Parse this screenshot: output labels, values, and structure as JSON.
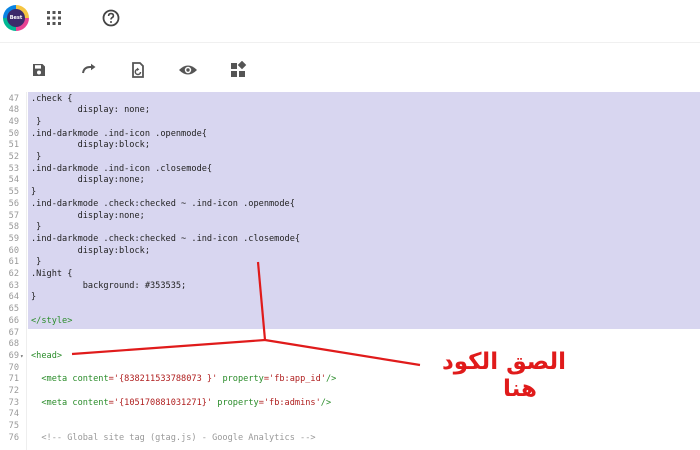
{
  "header": {
    "logo_text": "Best A+",
    "apps_icon": "apps-grid-icon",
    "help_icon": "help-circle-icon"
  },
  "toolbar": {
    "buttons": [
      {
        "name": "save-button",
        "icon": "save-icon"
      },
      {
        "name": "redo-button",
        "icon": "redo-icon"
      },
      {
        "name": "revert-button",
        "icon": "revert-icon"
      },
      {
        "name": "preview-button",
        "icon": "eye-icon"
      },
      {
        "name": "widgets-button",
        "icon": "widgets-icon"
      }
    ]
  },
  "editor": {
    "lines": [
      {
        "n": "47",
        "text": ".check {",
        "kind": "plain"
      },
      {
        "n": "48",
        "text": "         display: none;",
        "kind": "plain"
      },
      {
        "n": "49",
        "text": " }",
        "kind": "plain"
      },
      {
        "n": "50",
        "text": ".ind-darkmode .ind-icon .openmode{",
        "kind": "plain"
      },
      {
        "n": "51",
        "text": "         display:block;",
        "kind": "plain"
      },
      {
        "n": "52",
        "text": " }",
        "kind": "plain"
      },
      {
        "n": "53",
        "text": ".ind-darkmode .ind-icon .closemode{",
        "kind": "plain"
      },
      {
        "n": "54",
        "text": "         display:none;",
        "kind": "plain"
      },
      {
        "n": "55",
        "text": "}",
        "kind": "plain"
      },
      {
        "n": "56",
        "text": ".ind-darkmode .check:checked ~ .ind-icon .openmode{",
        "kind": "plain"
      },
      {
        "n": "57",
        "text": "         display:none;",
        "kind": "plain"
      },
      {
        "n": "58",
        "text": " }",
        "kind": "plain"
      },
      {
        "n": "59",
        "text": ".ind-darkmode .check:checked ~ .ind-icon .closemode{",
        "kind": "plain"
      },
      {
        "n": "60",
        "text": "         display:block;",
        "kind": "plain"
      },
      {
        "n": "61",
        "text": " }",
        "kind": "plain"
      },
      {
        "n": "62",
        "text": ".Night {",
        "kind": "plain"
      },
      {
        "n": "63",
        "text": "          background: #353535;",
        "kind": "plain"
      },
      {
        "n": "64",
        "text": "}",
        "kind": "plain"
      },
      {
        "n": "65",
        "text": "",
        "kind": "plain"
      },
      {
        "n": "66",
        "text": "</style>",
        "kind": "tag"
      },
      {
        "n": "67",
        "text": "",
        "kind": "plain"
      },
      {
        "n": "68",
        "text": "",
        "kind": "plain"
      },
      {
        "n": "69",
        "text": "<head>",
        "kind": "tag",
        "fold": "▾"
      },
      {
        "n": "70",
        "text": "",
        "kind": "plain"
      },
      {
        "n": "71",
        "text": "  <meta content='{838211533788073 }' property='fb:app_id'/>",
        "kind": "meta1"
      },
      {
        "n": "72",
        "text": "",
        "kind": "plain"
      },
      {
        "n": "73",
        "text": "  <meta content='{105170881031271}' property='fb:admins'/>",
        "kind": "meta2"
      },
      {
        "n": "74",
        "text": "",
        "kind": "plain"
      },
      {
        "n": "75",
        "text": "",
        "kind": "plain"
      },
      {
        "n": "76",
        "text": "  <!-- Global site tag (gtag.js) - Google Analytics -->",
        "kind": "comment"
      }
    ],
    "meta1": {
      "open": "  <meta ",
      "a1": "content",
      "v1": "='{838211533788073 }'",
      "a2": " property",
      "v2": "='fb:app_id'",
      "close": "/>"
    },
    "meta2": {
      "open": "  <meta ",
      "a1": "content",
      "v1": "='{105170881031271}'",
      "a2": " property",
      "v2": "='fb:admins'",
      "close": "/>"
    }
  },
  "annotation": {
    "line1": "الصق الكود",
    "line2": "هنا",
    "color": "#e01b1b"
  },
  "colors": {
    "selection": "#d8d6f0",
    "tag": "#2a8c2a",
    "string": "#b02020"
  }
}
